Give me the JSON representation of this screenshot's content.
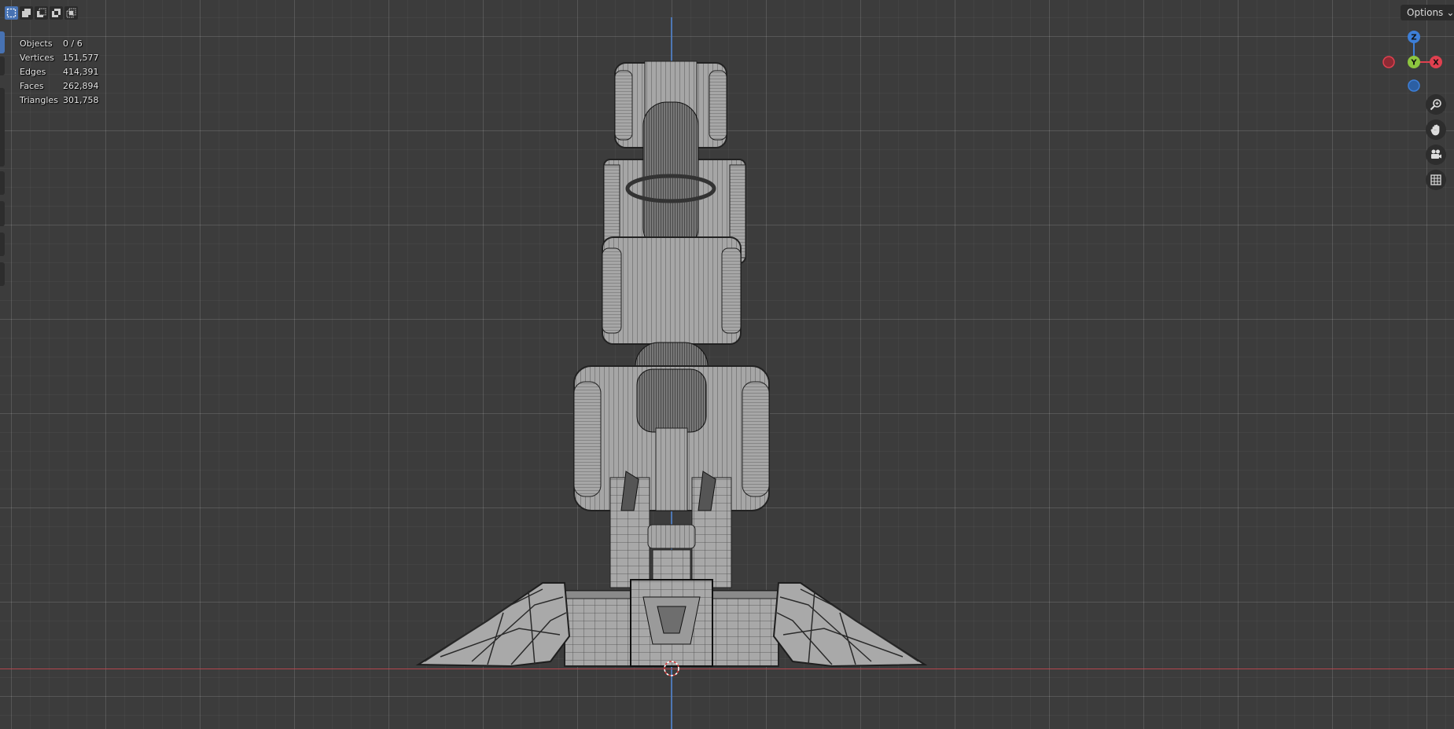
{
  "header": {
    "options_label": "Options",
    "select_modes": [
      "select-set-icon",
      "select-extend-icon",
      "select-subtract-icon",
      "select-difference-icon",
      "select-intersect-icon"
    ]
  },
  "stats": {
    "objects_label": "Objects",
    "objects_value": "0 / 6",
    "vertices_label": "Vertices",
    "vertices_value": "151,577",
    "edges_label": "Edges",
    "edges_value": "414,391",
    "faces_label": "Faces",
    "faces_value": "262,894",
    "triangles_label": "Triangles",
    "triangles_value": "301,758"
  },
  "gizmo": {
    "z_label": "Z",
    "y_label": "Y",
    "x_label": "X",
    "colors": {
      "x": "#e0404f",
      "y": "#8dc63f",
      "z": "#3d7fd8"
    }
  },
  "nav_tools": [
    "zoom-icon",
    "pan-hand-icon",
    "camera-view-icon",
    "orthographic-grid-icon"
  ],
  "colors": {
    "background": "#3c3c3c",
    "active": "#4772b3",
    "mesh_fill": "#a3a3a3",
    "mesh_dark": "#2a2a2a"
  }
}
